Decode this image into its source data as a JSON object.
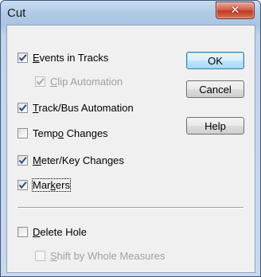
{
  "window": {
    "title": "Cut",
    "close_glyph": "✕"
  },
  "checkboxes": [
    {
      "id": "events-in-tracks",
      "pre": "",
      "ul": "E",
      "post": "vents in Tracks",
      "checked": true,
      "disabled": false
    },
    {
      "id": "clip-automation",
      "pre": "",
      "ul": "C",
      "post": "lip Automation",
      "checked": true,
      "disabled": true
    },
    {
      "id": "track-bus-automation",
      "pre": "",
      "ul": "T",
      "post": "rack/Bus Automation",
      "checked": true,
      "disabled": false
    },
    {
      "id": "tempo-changes",
      "pre": "Temp",
      "ul": "o",
      "post": " Changes",
      "checked": false,
      "disabled": false
    },
    {
      "id": "meter-key-changes",
      "pre": "",
      "ul": "M",
      "post": "eter/Key Changes",
      "checked": true,
      "disabled": false
    },
    {
      "id": "markers",
      "pre": "Mar",
      "ul": "k",
      "post": "ers",
      "checked": true,
      "disabled": false
    },
    {
      "id": "delete-hole",
      "pre": "",
      "ul": "D",
      "post": "elete Hole",
      "checked": false,
      "disabled": false
    },
    {
      "id": "shift-by-whole-measures",
      "pre": "",
      "ul": "S",
      "post": "hift by Whole Measures",
      "checked": false,
      "disabled": true
    }
  ],
  "buttons": {
    "ok": "OK",
    "cancel": "Cancel",
    "help": "Help"
  },
  "colors": {
    "check_enabled": "#2a4b8a",
    "check_disabled": "#a8a8a8"
  }
}
